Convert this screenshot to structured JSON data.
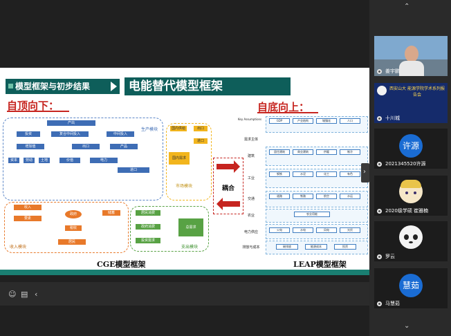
{
  "slide": {
    "section_title": "模型框架与初步结果",
    "main_title": "电能替代模型框架",
    "top_down": "自顶向下：",
    "bottom_up": "自底向上：",
    "coupling_label": "耦合",
    "cge_caption": "CGE模型框架",
    "leap_caption": "LEAP模型框架",
    "cge": {
      "production_module": "生产模块",
      "market_module": "市场模块",
      "income_module": "收入模块",
      "expenditure_module": "支出模块",
      "boxes_blue": [
        "产出",
        "投资",
        "复合中间投入",
        "资本",
        "劳动",
        "土地",
        "电力",
        "价值",
        "进口",
        "出口",
        "增加值",
        "中间投入",
        "产品"
      ],
      "boxes_orange": [
        "收入",
        "要素",
        "政府",
        "储蓄",
        "税收",
        "居民"
      ],
      "boxes_green": [
        "居民消费",
        "政府消费",
        "投资需求",
        "总需求"
      ],
      "boxes_yellow": [
        "国内供给",
        "出口",
        "进口",
        "国内需求"
      ]
    },
    "leap": {
      "key_assumptions": "Key Assumptions",
      "rows": [
        {
          "label": "需求主体",
          "items": [
            "GDP",
            "产业结构",
            "城镇化",
            "人口"
          ]
        },
        {
          "label": "建筑",
          "items": [
            "居住建筑",
            "商业建筑",
            "供暖",
            "制冷"
          ]
        },
        {
          "label": "工业",
          "items": [
            "钢铁",
            "水泥",
            "化工",
            "有色"
          ]
        },
        {
          "label": "交通",
          "items": [
            "道路",
            "铁路",
            "航空",
            "水运"
          ]
        },
        {
          "label": "农业",
          "items": [
            "农业用能"
          ]
        },
        {
          "label": "电力供应",
          "items": [
            "火电",
            "水电",
            "风电",
            "光伏"
          ]
        },
        {
          "label": "排放与成本",
          "items": [
            "碳排放",
            "能源成本",
            "投资"
          ]
        }
      ]
    }
  },
  "toolbar": {
    "emoji_icon": "smile-icon",
    "chat_icon": "chat-icon",
    "collapse_icon": "chevron-left-icon"
  },
  "participants": [
    {
      "name": "姜宇鹏",
      "type": "camera"
    },
    {
      "name": "十川城",
      "type": "banner",
      "banner_text": "西安山大 能源学院学术系列报告会"
    },
    {
      "name": "2021345520许源",
      "type": "avatar",
      "avatar_text": "许源"
    },
    {
      "name": "2020级学硕 崔雅楠",
      "type": "cartoon"
    },
    {
      "name": "罗云",
      "type": "panda"
    },
    {
      "name": "马慧茹",
      "type": "avatar",
      "avatar_text": "慧茹"
    }
  ]
}
